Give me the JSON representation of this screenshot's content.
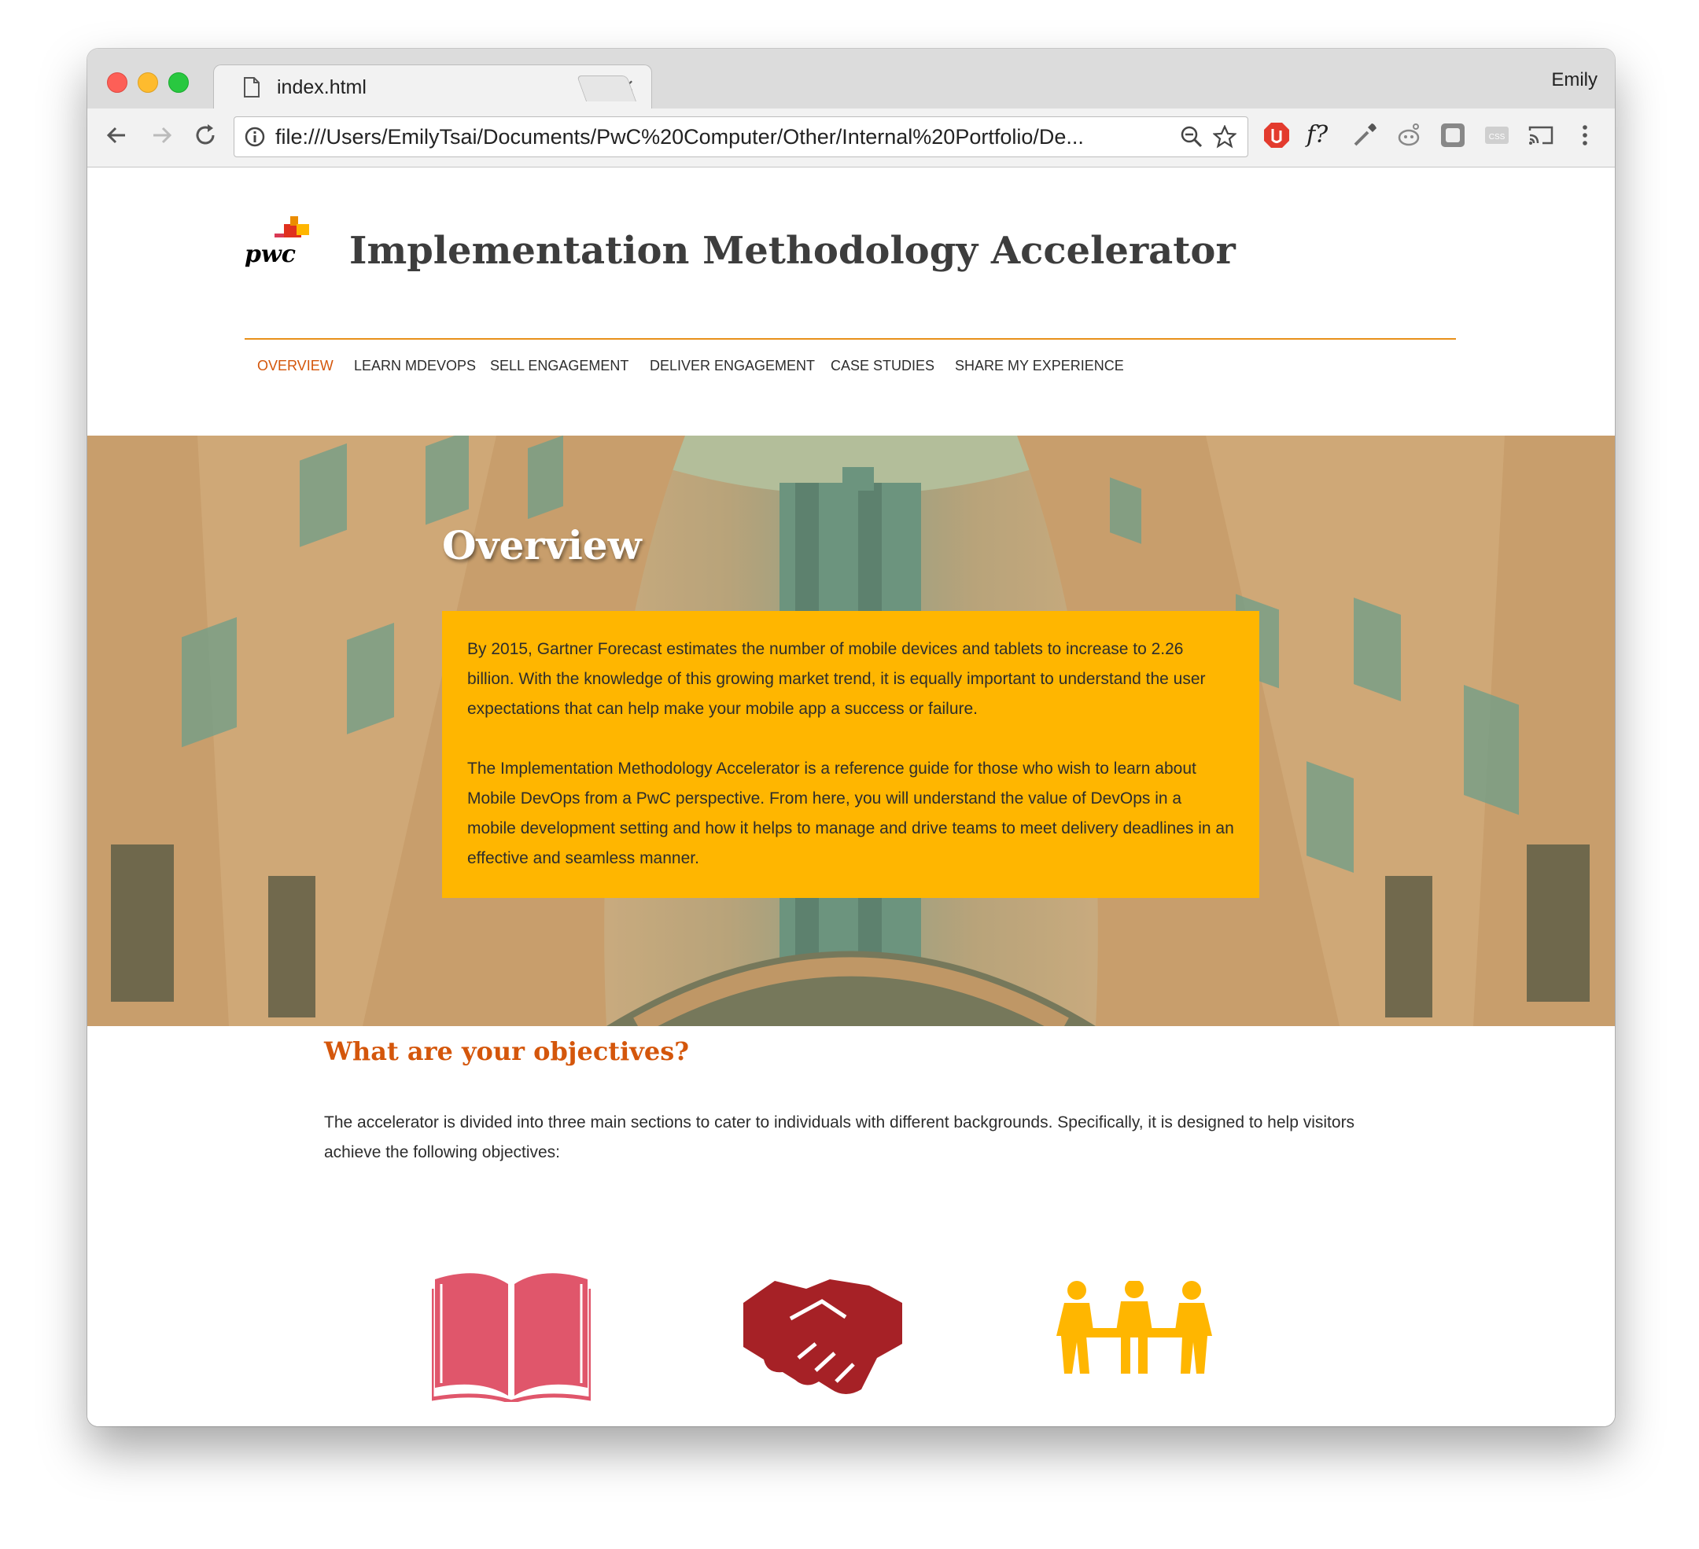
{
  "browser": {
    "tab_title": "index.html",
    "tab_close": "×",
    "profile_name": "Emily",
    "url": "file:///Users/EmilyTsai/Documents/PwC%20Computer/Other/Internal%20Portfolio/De...",
    "icons": [
      "back-icon",
      "forward-icon",
      "reload-icon",
      "info-icon",
      "zoom-icon",
      "star-icon",
      "adblock-icon",
      "font-icon",
      "eyedropper-icon",
      "reddit-icon",
      "extension-icon",
      "css-icon",
      "cast-icon",
      "menu-icon"
    ],
    "extension_font_label": "f?"
  },
  "site": {
    "logo_text": "pwc",
    "title": "Implementation Methodology Accelerator",
    "nav": [
      {
        "label": "OVERVIEW",
        "active": true
      },
      {
        "label": "LEARN MDEVOPS",
        "active": false
      },
      {
        "label": "SELL ENGAGEMENT",
        "active": false
      },
      {
        "label": "DELIVER ENGAGEMENT",
        "active": false
      },
      {
        "label": "CASE STUDIES",
        "active": false
      },
      {
        "label": "SHARE MY EXPERIENCE",
        "active": false
      }
    ],
    "accent_color": "#d4560b",
    "box_color": "#ffb600"
  },
  "hero": {
    "title": "Overview",
    "paragraph1": "By 2015, Gartner Forecast estimates the number of mobile devices and tablets to increase to 2.26 billion. With the knowledge of this growing market trend, it is equally important to understand the user expectations that can help make your mobile app a success or failure.",
    "paragraph2": "The Implementation Methodology Accelerator is a reference guide for those who wish to learn about Mobile DevOps from a PwC perspective. From here, you will understand the value of DevOps in a mobile development setting and how it helps to manage and drive teams to meet delivery deadlines in an effective and seamless manner."
  },
  "objectives": {
    "title": "What are your objectives?",
    "text": "The accelerator is divided into three main sections to cater to individuals with different backgrounds. Specifically, it is designed to help visitors achieve the following objectives:",
    "icons": [
      {
        "name": "book-icon",
        "color": "#e0566b"
      },
      {
        "name": "handshake-icon",
        "color": "#a62126"
      },
      {
        "name": "meeting-icon",
        "color": "#ffb600"
      }
    ]
  }
}
